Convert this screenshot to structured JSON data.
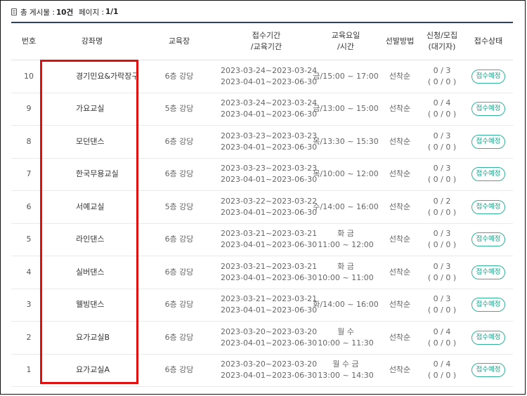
{
  "summary": {
    "total_label": "총 게시물 :",
    "total_value": "10건",
    "page_label": "페이지 :",
    "page_value": "1/1"
  },
  "columns": [
    "번호",
    "강좌명",
    "교육장",
    "접수기간\n/교육기간",
    "교육요일\n/시간",
    "선발방법",
    "신청/모집\n(대기자)",
    "접수상태"
  ],
  "rows": [
    {
      "no": "10",
      "title": "경기민요&가락장구",
      "room": "6층 강당",
      "period": "2023-03-24~2023-03-24\n2023-04-01~2023-06-30",
      "schedule": "금/15:00 ~ 17:00",
      "method": "선착순",
      "count": "0 / 3\n( 0 / 0 )",
      "status": "접수예정"
    },
    {
      "no": "9",
      "title": "가요교실",
      "room": "5층 강당",
      "period": "2023-03-24~2023-03-24\n2023-04-01~2023-06-30",
      "schedule": "금/13:00 ~ 15:00",
      "method": "선착순",
      "count": "0 / 4\n( 0 / 0 )",
      "status": "접수예정"
    },
    {
      "no": "8",
      "title": "모던댄스",
      "room": "6층 강당",
      "period": "2023-03-23~2023-03-23\n2023-04-01~2023-06-30",
      "schedule": "목/13:30 ~ 15:30",
      "method": "선착순",
      "count": "0 / 3\n( 0 / 0 )",
      "status": "접수예정"
    },
    {
      "no": "7",
      "title": "한국무용교실",
      "room": "6층 강당",
      "period": "2023-03-23~2023-03-23\n2023-04-01~2023-06-30",
      "schedule": "목/10:00 ~ 12:00",
      "method": "선착순",
      "count": "0 / 3\n( 0 / 0 )",
      "status": "접수예정"
    },
    {
      "no": "6",
      "title": "서예교실",
      "room": "5층 강당",
      "period": "2023-03-22~2023-03-22\n2023-04-01~2023-06-30",
      "schedule": "수/14:00 ~ 16:00",
      "method": "선착순",
      "count": "0 / 2\n( 0 / 0 )",
      "status": "접수예정"
    },
    {
      "no": "5",
      "title": "라인댄스",
      "room": "6층 강당",
      "period": "2023-03-21~2023-03-21\n2023-04-01~2023-06-30",
      "schedule": "화 금\n11:00 ~ 12:00",
      "method": "선착순",
      "count": "0 / 3\n( 0 / 0 )",
      "status": "접수예정"
    },
    {
      "no": "4",
      "title": "실버댄스",
      "room": "6층 강당",
      "period": "2023-03-21~2023-03-21\n2023-04-01~2023-06-30",
      "schedule": "화 금\n10:00 ~ 11:00",
      "method": "선착순",
      "count": "0 / 3\n( 0 / 0 )",
      "status": "접수예정"
    },
    {
      "no": "3",
      "title": "웰빙댄스",
      "room": "6층 강당",
      "period": "2023-03-21~2023-03-21\n2023-04-01~2023-06-30",
      "schedule": "화/14:00 ~ 16:00",
      "method": "선착순",
      "count": "0 / 3\n( 0 / 0 )",
      "status": "접수예정"
    },
    {
      "no": "2",
      "title": "요가교실B",
      "room": "6층 강당",
      "period": "2023-03-20~2023-03-20\n2023-04-01~2023-06-30",
      "schedule": "월 수\n10:00 ~ 11:30",
      "method": "선착순",
      "count": "0 / 4\n( 0 / 0 )",
      "status": "접수예정"
    },
    {
      "no": "1",
      "title": "요가교실A",
      "room": "6층 강당",
      "period": "2023-03-20~2023-03-20\n2023-04-01~2023-06-30",
      "schedule": "월 수 금\n13:00 ~ 14:30",
      "method": "선착순",
      "count": "0 / 4\n( 0 / 0 )",
      "status": "접수예정"
    }
  ],
  "colors": {
    "header_rule": "#2f3f6b",
    "status_accent": "#2fb39a",
    "highlight": "#e01010"
  }
}
